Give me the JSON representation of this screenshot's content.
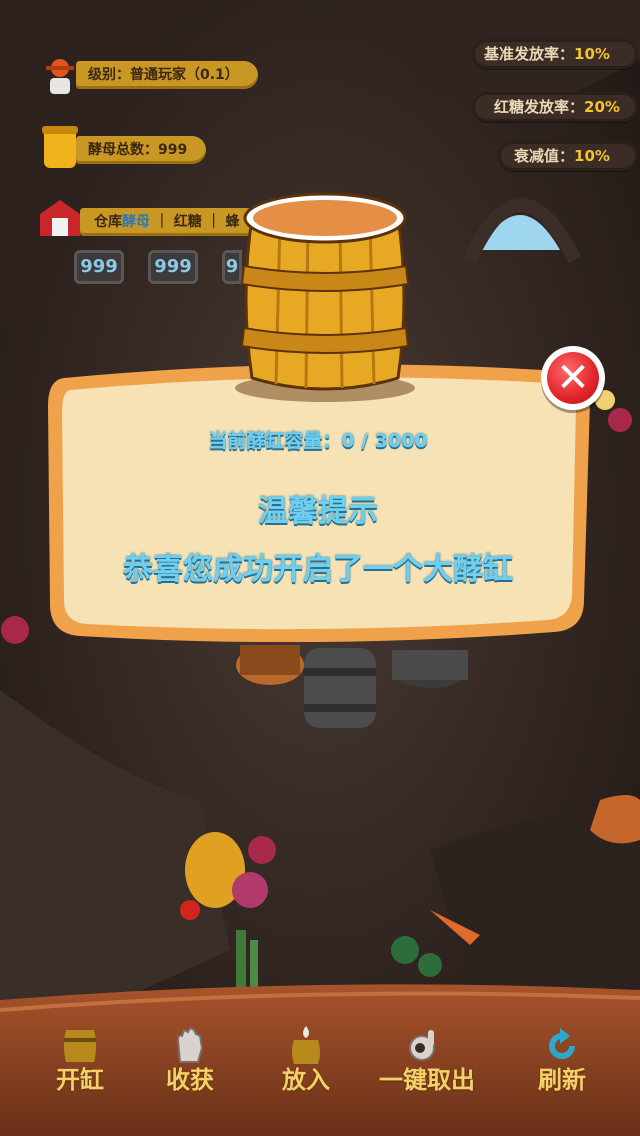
{
  "colors": {
    "accent_blue": "#6ecff0",
    "gold": "#f2c22f",
    "close_red": "#e0242a",
    "parchment": "#f4dfb0"
  },
  "stats": {
    "level": "级别：普通玩家（0.1）",
    "yeast_total": "酵母总数：999",
    "warehouse_prefix": "仓库",
    "warehouse_yeast": "酵母",
    "warehouse_sep1": "｜",
    "warehouse_sugar": "红糖",
    "warehouse_sep2": "｜",
    "warehouse_third": "蜂",
    "counts": [
      "999",
      "999",
      "9"
    ]
  },
  "rates": [
    {
      "label": "基准发放率：",
      "value": "10%"
    },
    {
      "label": "红糖发放率：",
      "value": "20%"
    },
    {
      "label": "衰减值：",
      "value": "10%"
    }
  ],
  "dialog": {
    "capacity": "当前酵缸容量：0 / 3000",
    "title": "温馨提示",
    "message": "恭喜您成功开启了一个大酵缸",
    "close_icon": "close-icon"
  },
  "toolbar": [
    {
      "label": "开缸",
      "icon": "barrel-icon"
    },
    {
      "label": "收获",
      "icon": "hand-icon"
    },
    {
      "label": "放入",
      "icon": "drop-barrel-icon"
    },
    {
      "label": "一键取出",
      "icon": "ok-hand-icon"
    },
    {
      "label": "刷新",
      "icon": "refresh-icon"
    }
  ]
}
